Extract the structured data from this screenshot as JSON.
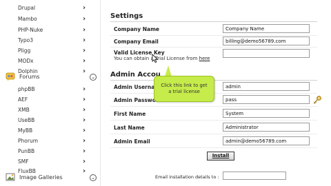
{
  "sidebar": {
    "items_top": [
      {
        "label": "Drupal"
      },
      {
        "label": "Mambo"
      },
      {
        "label": "PHP-Nuke"
      },
      {
        "label": "Typo3"
      },
      {
        "label": "Pligg"
      },
      {
        "label": "MODx"
      },
      {
        "label": "Dolphin"
      }
    ],
    "forums": {
      "label": "Forums",
      "toggle": "⌄",
      "icon": "forums-icon"
    },
    "forum_items": [
      {
        "label": "phpBB"
      },
      {
        "label": "AEF"
      },
      {
        "label": "XMB"
      },
      {
        "label": "UseBB"
      },
      {
        "label": "MyBB"
      },
      {
        "label": "Phorum"
      },
      {
        "label": "PunBB"
      },
      {
        "label": "SMF"
      },
      {
        "label": "FluxBB"
      }
    ],
    "galleries": {
      "label": "Image Galleries",
      "toggle": "⌄",
      "icon": "image-galleries-icon"
    },
    "chevron": "›"
  },
  "main": {
    "settings_title": "Settings",
    "admin_title": "Admin Accou",
    "fields": {
      "company_name": {
        "label": "Company Name",
        "value": "Company Name"
      },
      "company_email": {
        "label": "Company Email",
        "value": "billing@demo56789.com"
      },
      "license_key": {
        "label": "Valid License Key",
        "value": "",
        "help_prefix": "You can obtain a Trial License from ",
        "help_link": "here"
      },
      "admin_username": {
        "label": "Admin Usernam",
        "value": "admin"
      },
      "admin_password": {
        "label": "Admin Password",
        "value": "pass"
      },
      "first_name": {
        "label": "First Name",
        "value": "System"
      },
      "last_name": {
        "label": "Last Name",
        "value": "Administrator"
      },
      "admin_email": {
        "label": "Admin Email",
        "value": "admin@demo56789.com"
      }
    },
    "install_label": "Install",
    "email_details_label": "Email installation details to :"
  },
  "tooltip": {
    "line1": "Click this link to get",
    "line2": "a trial license"
  },
  "colors": {
    "bubble": "#c6ec4b",
    "bubble_border": "#9ac21a"
  }
}
